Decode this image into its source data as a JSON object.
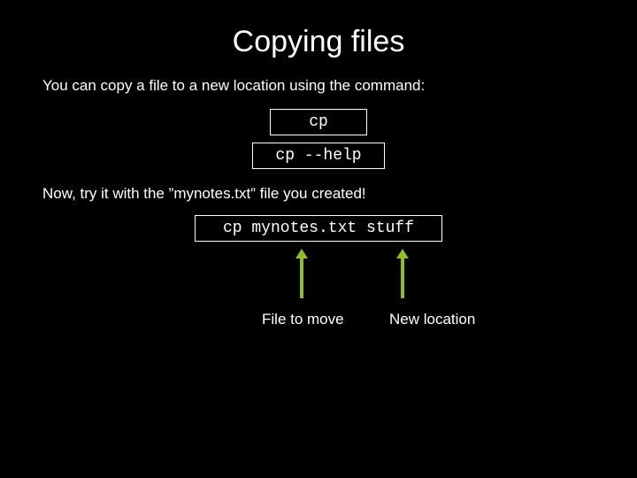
{
  "title": "Copying files",
  "intro": "You can copy a file to a new location using the command:",
  "cmd1": "cp",
  "cmd2": "cp --help",
  "prompt": "Now, try it with the ”mynotes.txt” file you created!",
  "cmd3": "cp mynotes.txt stuff",
  "label_source": "File to move",
  "label_dest": "New location"
}
